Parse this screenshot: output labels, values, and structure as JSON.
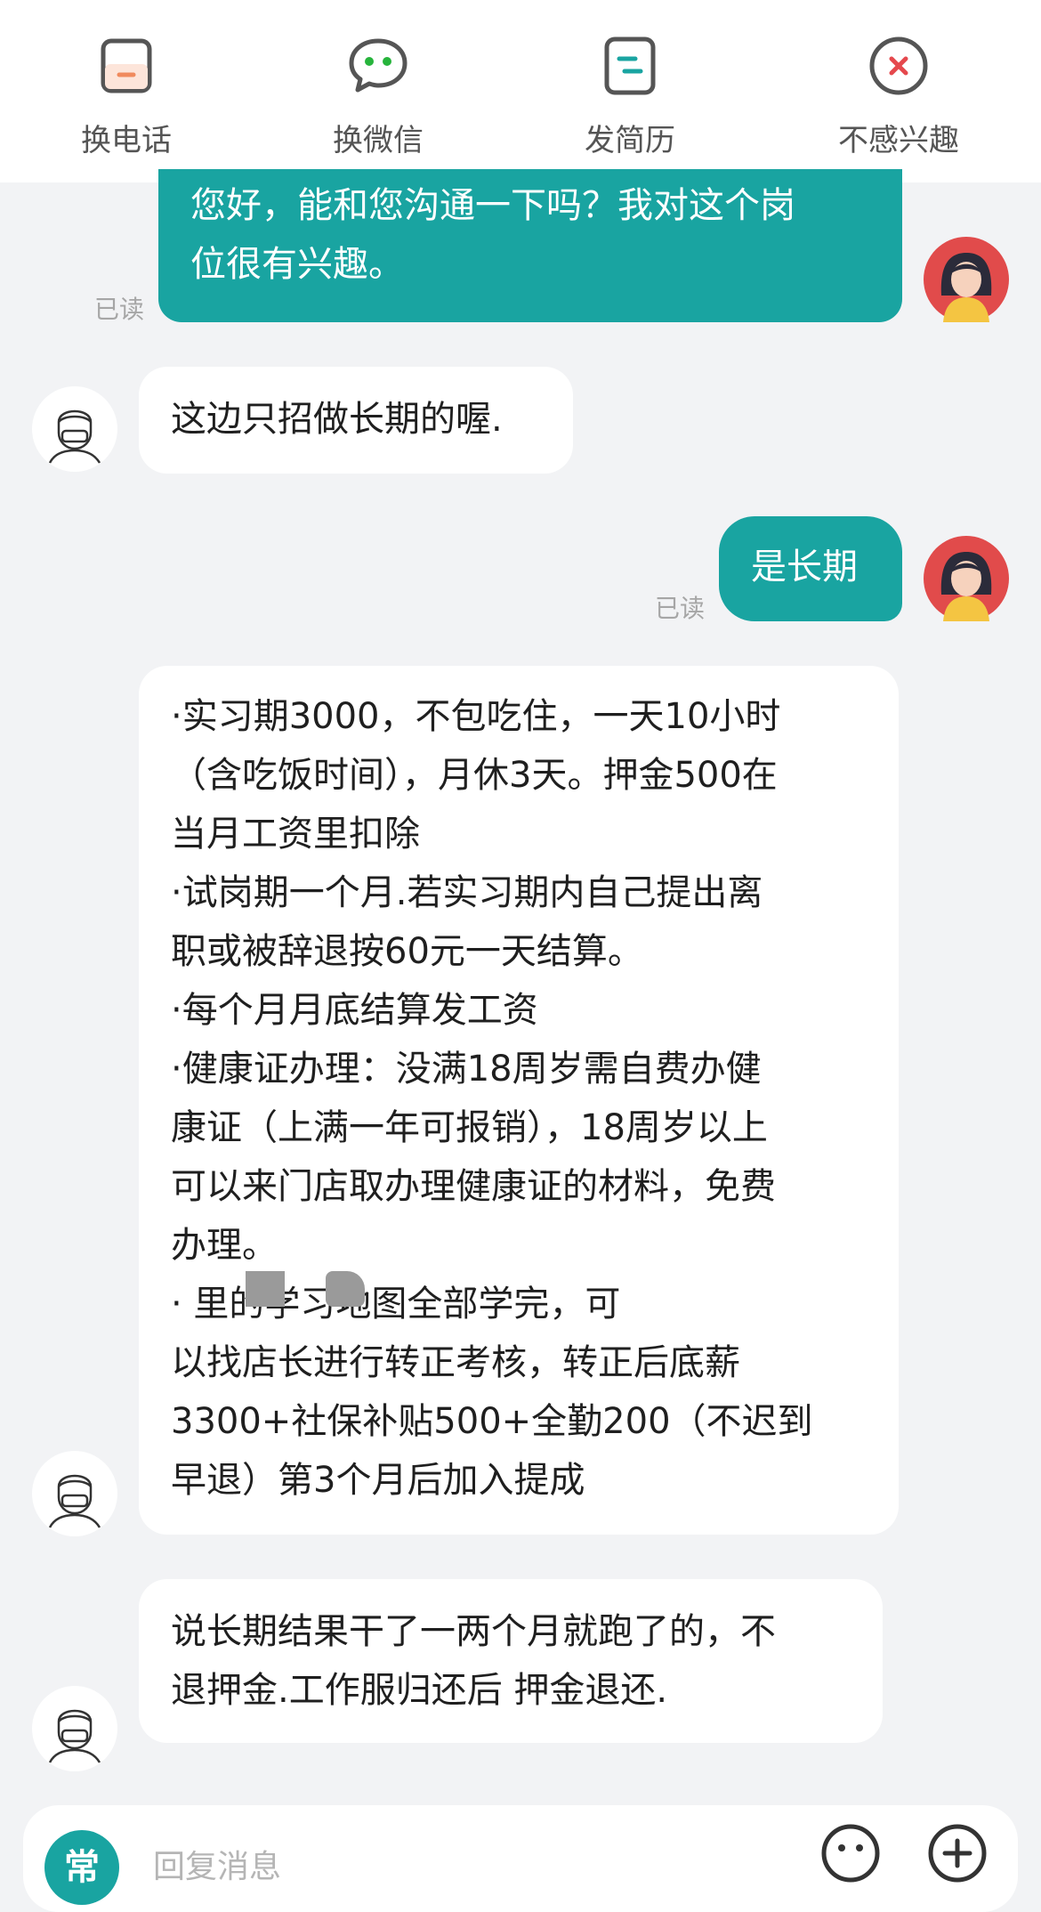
{
  "top_actions": [
    {
      "label": "换电话",
      "icon": "phone-icon"
    },
    {
      "label": "换微信",
      "icon": "wechat-icon"
    },
    {
      "label": "发简历",
      "icon": "resume-icon"
    },
    {
      "label": "不感兴趣",
      "icon": "not-interested-icon"
    }
  ],
  "colors": {
    "accent": "#19a4a1",
    "danger": "#e5484d",
    "phone_orange": "#f08a5d"
  },
  "messages": [
    {
      "from": "me",
      "text": "您好，能和您沟通一下吗？我对这个岗\n位很有兴趣。",
      "status": "已读"
    },
    {
      "from": "them",
      "text": "这边只招做长期的喔."
    },
    {
      "from": "me",
      "text": "是长期",
      "status": "已读"
    },
    {
      "from": "them",
      "text": "·实习期3000，不包吃住，一天10小时\n（含吃饭时间），月休3天。押金500在\n当月工资里扣除\n·试岗期一个月.若实习期内自己提出离\n职或被辞退按60元一天结算。\n·每个月月底结算发工资\n·健康证办理：没满18周岁需自费办健\n康证（上满一年可报销），18周岁以上\n可以来门店取办理健康证的材料，免费\n办理。\n·              里的学习地图全部学完，可\n以找店长进行转正考核，转正后底薪\n3300+社保补贴500+全勤200（不迟到\n早退）第3个月后加入提成"
    },
    {
      "from": "them",
      "text": "说长期结果干了一两个月就跑了的，不\n退押金.工作服归还后 押金退还."
    }
  ],
  "input": {
    "placeholder": "回复消息",
    "quick_label": "常"
  }
}
